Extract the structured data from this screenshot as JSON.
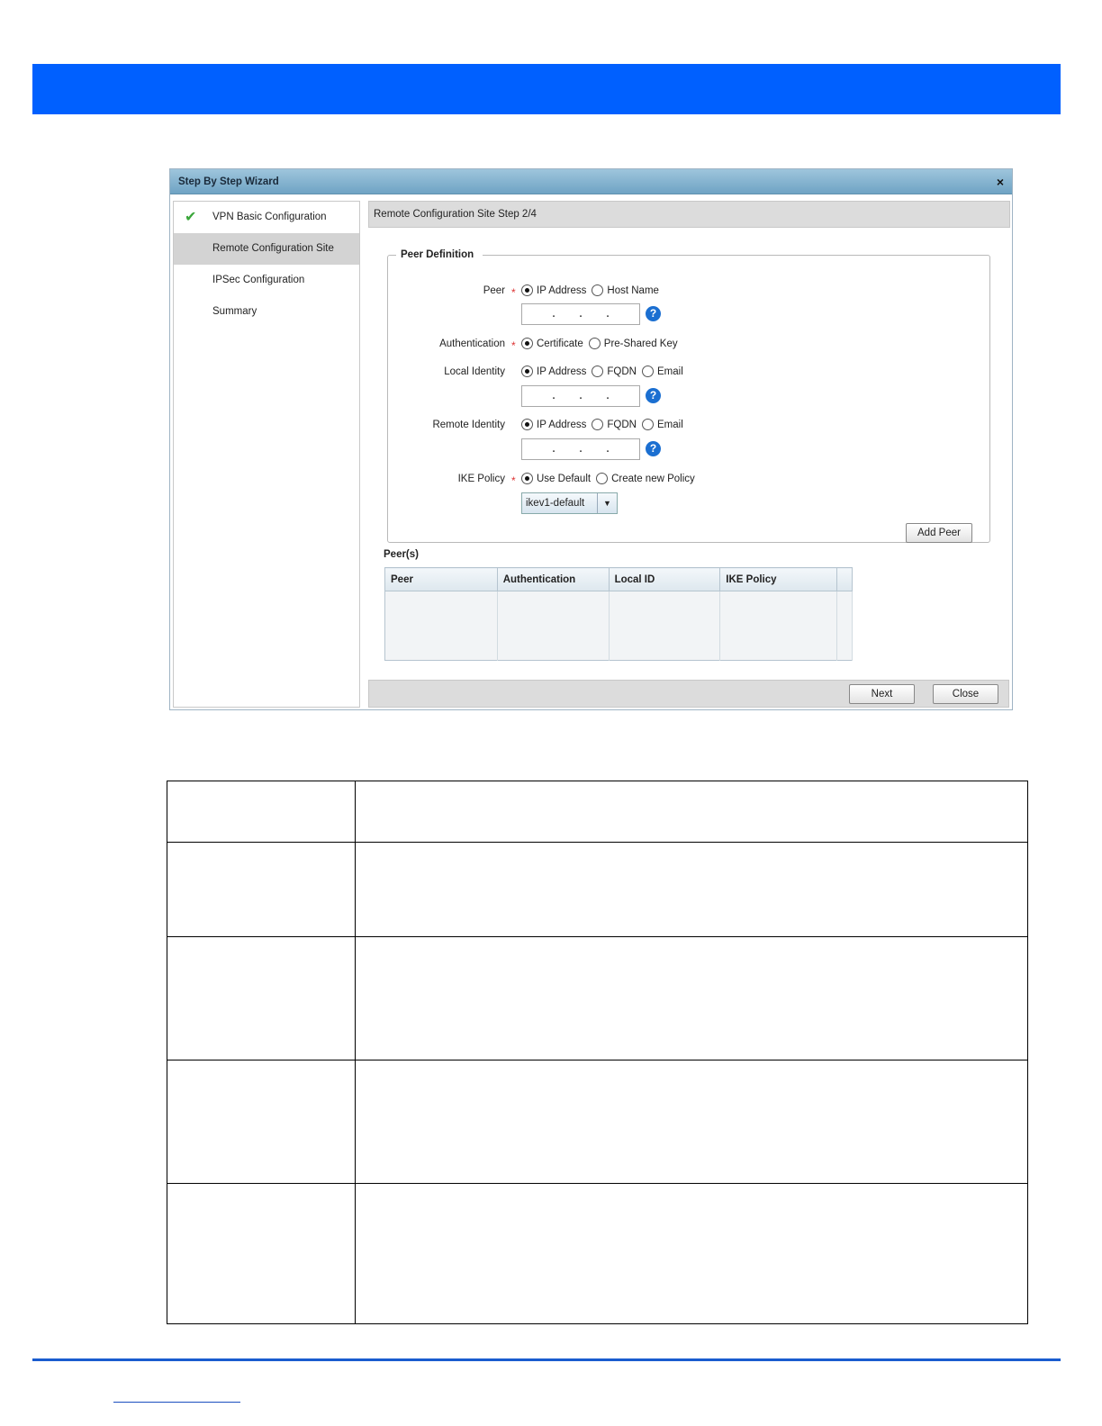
{
  "wizard": {
    "title": "Step By Step Wizard",
    "close_glyph": "×",
    "steps": [
      {
        "label": "VPN Basic Configuration",
        "completed": true
      },
      {
        "label": "Remote Configuration Site",
        "active": true
      },
      {
        "label": "IPSec Configuration"
      },
      {
        "label": "Summary"
      }
    ],
    "step_header": "Remote Configuration Site  Step 2/4",
    "peer_definition": {
      "legend": "Peer Definition",
      "peer": {
        "label": "Peer",
        "options": [
          "IP Address",
          "Host Name"
        ],
        "selected": "IP Address",
        "ip_dots": [
          ".",
          ".",
          "."
        ]
      },
      "authentication": {
        "label": "Authentication",
        "options": [
          "Certificate",
          "Pre-Shared Key"
        ],
        "selected": "Certificate"
      },
      "local_identity": {
        "label": "Local Identity",
        "options": [
          "IP Address",
          "FQDN",
          "Email"
        ],
        "selected": "IP Address",
        "ip_dots": [
          ".",
          ".",
          "."
        ]
      },
      "remote_identity": {
        "label": "Remote Identity",
        "options": [
          "IP Address",
          "FQDN",
          "Email"
        ],
        "selected": "IP Address",
        "ip_dots": [
          ".",
          ".",
          "."
        ]
      },
      "ike_policy": {
        "label": "IKE Policy",
        "options": [
          "Use Default",
          "Create new Policy"
        ],
        "selected": "Use Default",
        "dropdown_value": "ikev1-default"
      },
      "required_mark": "*",
      "help_glyph": "?",
      "add_peer_label": "Add Peer"
    },
    "peers": {
      "title": "Peer(s)",
      "columns": [
        "Peer",
        "Authentication",
        "Local ID",
        "IKE Policy"
      ]
    },
    "next_label": "Next",
    "close_label": "Close"
  },
  "colors": {
    "banner": "#0060ff",
    "accent": "#1b6fd1",
    "check": "#3aa63a"
  }
}
